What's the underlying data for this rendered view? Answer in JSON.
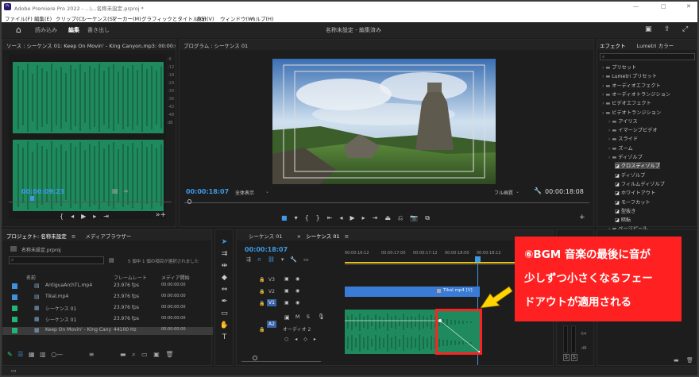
{
  "app": {
    "title": "Adobe Premiere Pro 2022 - ...\\...名称未設定.prproj *",
    "window_controls": [
      "—",
      "□",
      "✕"
    ]
  },
  "menu": [
    "ファイル(F)",
    "編集(E)",
    "クリップ(C)",
    "シーケンス(S)",
    "マーカー(M)",
    "グラフィックとタイトル(G)",
    "表示(V)",
    "ウィンドウ(W)",
    "ヘルプ(H)"
  ],
  "workspace": {
    "tabs": [
      "読み込み",
      "編集",
      "書き出し"
    ],
    "center_title": "名称未設定 - 編集済み"
  },
  "source": {
    "title": "ソース : シーケンス 01: Keep On Movin' - King Canyon.mp3: 00:00:07:1",
    "timecode": "00:00:09:23",
    "ruler_marks": [
      "-6",
      "-12",
      "-18",
      "-24",
      "-30",
      "-36",
      "-42",
      "-48",
      "dB"
    ]
  },
  "program": {
    "title": "プログラム : シーケンス 01",
    "timecode": "00:00:18:07",
    "zoom": "全体表示",
    "quality": "フル画質",
    "duration": "00:00:18:08"
  },
  "project": {
    "tabs": [
      "プロジェクト: 名称未設定",
      "メディアブラウザー"
    ],
    "filename": "名称未設定.prproj",
    "selection": "5 個中 1 個の項目が選択されました",
    "columns": [
      "名前",
      "フレームレート",
      "メディア開始"
    ],
    "items": [
      {
        "name": "AntiguaArchTL.mp4",
        "rate": "23.976 fps",
        "start": "00:00:00:00",
        "color": "#3f8fd9"
      },
      {
        "name": "Tikal.mp4",
        "rate": "23.976 fps",
        "start": "00:00:00:00",
        "color": "#3f8fd9"
      },
      {
        "name": "シーケンス 01",
        "rate": "23.976 fps",
        "start": "00:00:00:00",
        "color": "#22b573"
      },
      {
        "name": "シーケンス 01",
        "rate": "23.976 fps",
        "start": "00:00:00:00",
        "color": "#22b573"
      },
      {
        "name": "Keep On Movin' - King Cany",
        "rate": "44100 Hz",
        "start": "00:00:00:00",
        "color": "#22b573"
      }
    ]
  },
  "timeline": {
    "tabs": [
      "シーケンス 01",
      "シーケンス 01"
    ],
    "timecode": "00:00:18:07",
    "ruler": [
      "00:00:16:12",
      "00:00:17:00",
      "00:00:17:12",
      "00:00:18:00",
      "00:00:18:12"
    ],
    "tracks": [
      "V3",
      "V2",
      "V1",
      "A2"
    ],
    "clip_label": "Tikal.mp4 [V]",
    "audio_track_name": "オーディオ 2"
  },
  "effects": {
    "tabs": [
      "エフェクト",
      "Lumetri カラー"
    ],
    "items": [
      {
        "label": "プリセット",
        "depth": 0
      },
      {
        "label": "Lumetri プリセット",
        "depth": 0
      },
      {
        "label": "オーディオエフェクト",
        "depth": 0
      },
      {
        "label": "オーディオトランジション",
        "depth": 0
      },
      {
        "label": "ビデオエフェクト",
        "depth": 0
      },
      {
        "label": "ビデオトランジション",
        "depth": 0
      },
      {
        "label": "アイリス",
        "depth": 1
      },
      {
        "label": "イマーシブビデオ",
        "depth": 1
      },
      {
        "label": "スライド",
        "depth": 1
      },
      {
        "label": "ズーム",
        "depth": 1
      },
      {
        "label": "ディゾルブ",
        "depth": 1
      },
      {
        "label": "クロスディゾルブ",
        "depth": 2,
        "selected": true
      },
      {
        "label": "ディゾルブ",
        "depth": 2
      },
      {
        "label": "フィルムディゾルブ",
        "depth": 2
      },
      {
        "label": "ホワイトアウト",
        "depth": 2
      },
      {
        "label": "モーフカット",
        "depth": 2
      },
      {
        "label": "型抜き",
        "depth": 2
      },
      {
        "label": "暗転",
        "depth": 2
      },
      {
        "label": "ページピール",
        "depth": 1
      }
    ]
  },
  "meter": {
    "labels": [
      "-54",
      "dB"
    ],
    "bottom": [
      "S",
      "S"
    ]
  },
  "annotation": {
    "text_lines": [
      "⑥BGM 音楽の最後に音が",
      "少しずつ小さくなるフェー",
      "ドアウトが適用される"
    ],
    "accent": "#ff2121",
    "arrow_color": "#ffd400"
  }
}
